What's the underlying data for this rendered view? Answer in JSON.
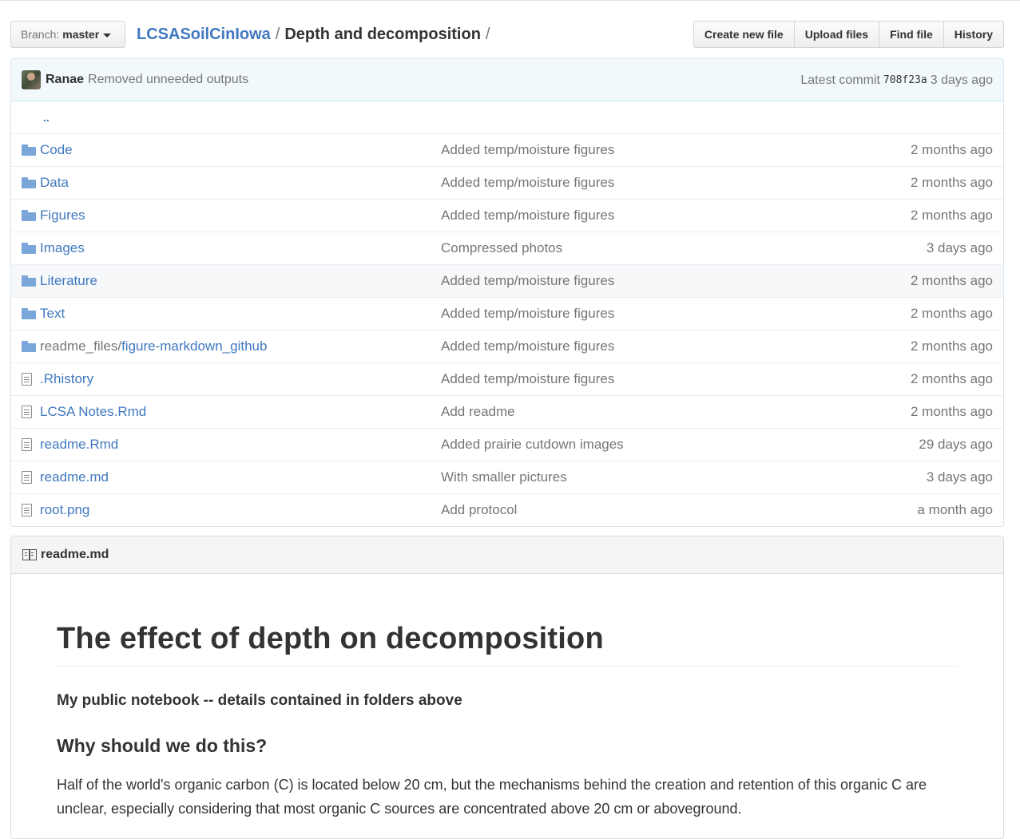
{
  "nav": {
    "branch_label": "Branch:",
    "branch_value": "master",
    "repo": "LCSASoilCinIowa",
    "separator": "/",
    "current_dir": "Depth and decomposition",
    "trailing_sep": "/",
    "buttons": [
      "Create new file",
      "Upload files",
      "Find file",
      "History"
    ]
  },
  "commit": {
    "author": "Ranae",
    "message": "Removed unneeded outputs",
    "latest_label": "Latest commit",
    "sha": "708f23a",
    "age": "3 days ago"
  },
  "parent_link": "..",
  "files": [
    {
      "type": "dir",
      "name": "Code",
      "message": "Added temp/moisture figures",
      "age": "2 months ago"
    },
    {
      "type": "dir",
      "name": "Data",
      "message": "Added temp/moisture figures",
      "age": "2 months ago"
    },
    {
      "type": "dir",
      "name": "Figures",
      "message": "Added temp/moisture figures",
      "age": "2 months ago"
    },
    {
      "type": "dir",
      "name": "Images",
      "message": "Compressed photos",
      "age": "3 days ago"
    },
    {
      "type": "dir",
      "name": "Literature",
      "message": "Added temp/moisture figures",
      "age": "2 months ago"
    },
    {
      "type": "dir",
      "name": "Text",
      "message": "Added temp/moisture figures",
      "age": "2 months ago"
    },
    {
      "type": "dir",
      "name_prefix": "readme_files/",
      "name": "figure-markdown_github",
      "message": "Added temp/moisture figures",
      "age": "2 months ago"
    },
    {
      "type": "file",
      "name": ".Rhistory",
      "message": "Added temp/moisture figures",
      "age": "2 months ago"
    },
    {
      "type": "file",
      "name": "LCSA Notes.Rmd",
      "message": "Add readme",
      "age": "2 months ago"
    },
    {
      "type": "file",
      "name": "readme.Rmd",
      "message": "Added prairie cutdown images",
      "age": "29 days ago"
    },
    {
      "type": "file",
      "name": "readme.md",
      "message": "With smaller pictures",
      "age": "3 days ago"
    },
    {
      "type": "file",
      "name": "root.png",
      "message": "Add protocol",
      "age": "a month ago"
    }
  ],
  "readme": {
    "filename": "readme.md",
    "title": "The effect of depth on decomposition",
    "lead": "My public notebook -- details contained in folders above",
    "heading": "Why should we do this?",
    "paragraph": "Half of the world's organic carbon (C) is located below 20 cm, but the mechanisms behind the creation and retention of this organic C are unclear, especially considering that most organic C sources are concentrated above 20 cm or aboveground."
  },
  "colors": {
    "link": "#4078c0",
    "commit_bg": "#f2f9fc",
    "folder": "#7aa6da"
  }
}
